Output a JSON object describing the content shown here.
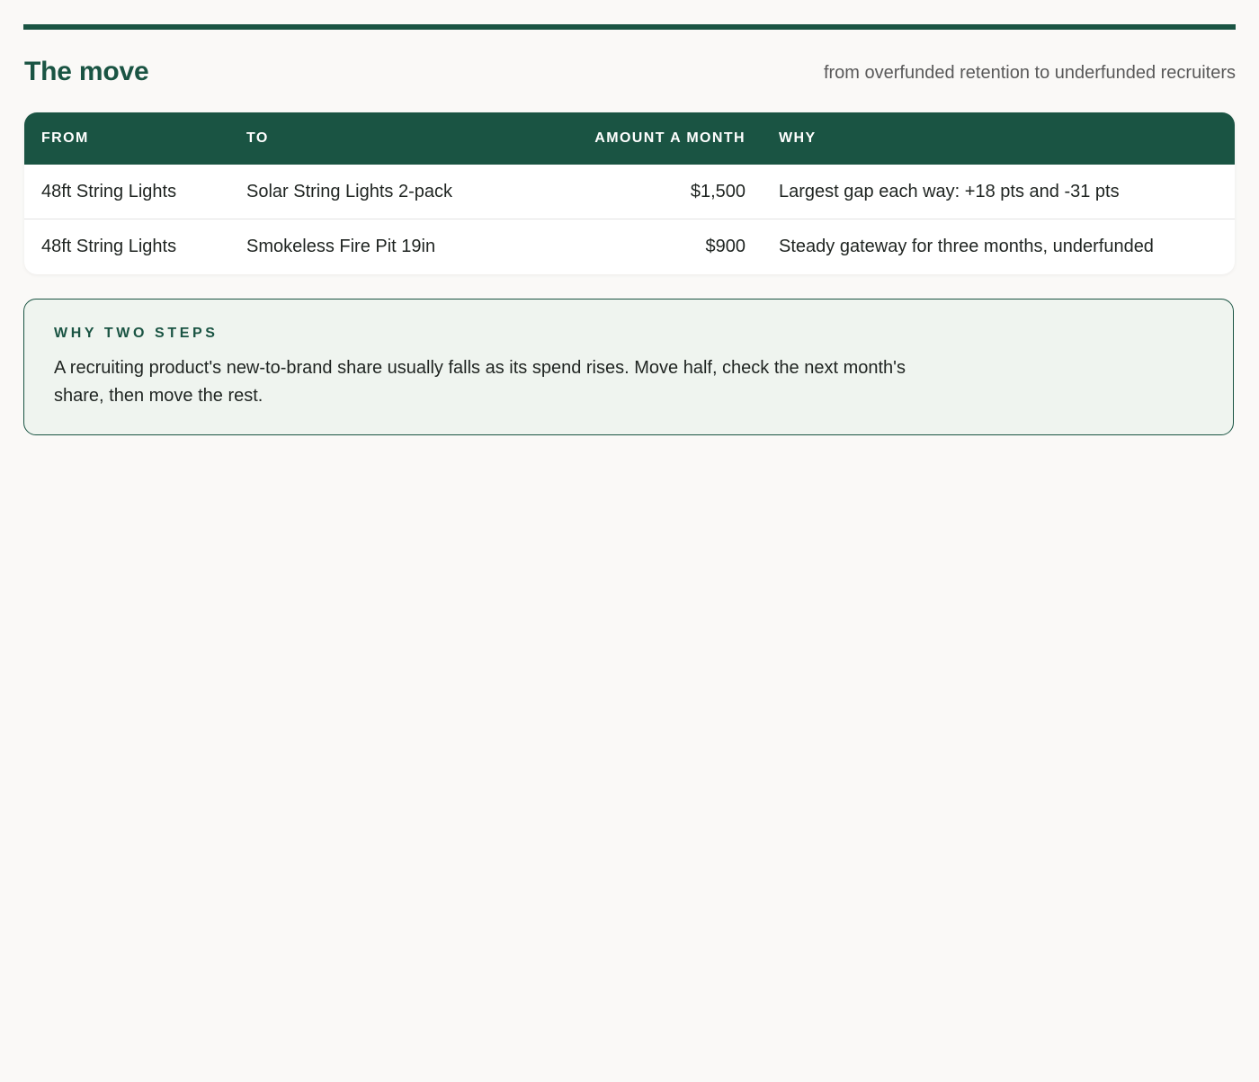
{
  "header": {
    "title": "The move",
    "subtitle": "from overfunded retention to underfunded recruiters"
  },
  "table": {
    "columns": {
      "from": "From",
      "to": "To",
      "amount": "Amount a month",
      "why": "Why"
    },
    "rows": [
      {
        "from": "48ft String Lights",
        "to": "Solar String Lights 2-pack",
        "amount": "$1,500",
        "why": "Largest gap each way: +18 pts and -31 pts"
      },
      {
        "from": "48ft String Lights",
        "to": "Smokeless Fire Pit 19in",
        "amount": "$900",
        "why": "Steady gateway for three months, underfunded"
      }
    ]
  },
  "note": {
    "label": "Why two steps",
    "body": "A recruiting product's new-to-brand share usually falls as its spend rises. Move half, check the next month's share, then move the rest."
  },
  "colors": {
    "accent": "#1a5443",
    "note_background": "#eff4ef",
    "page_background": "#faf9f7"
  }
}
